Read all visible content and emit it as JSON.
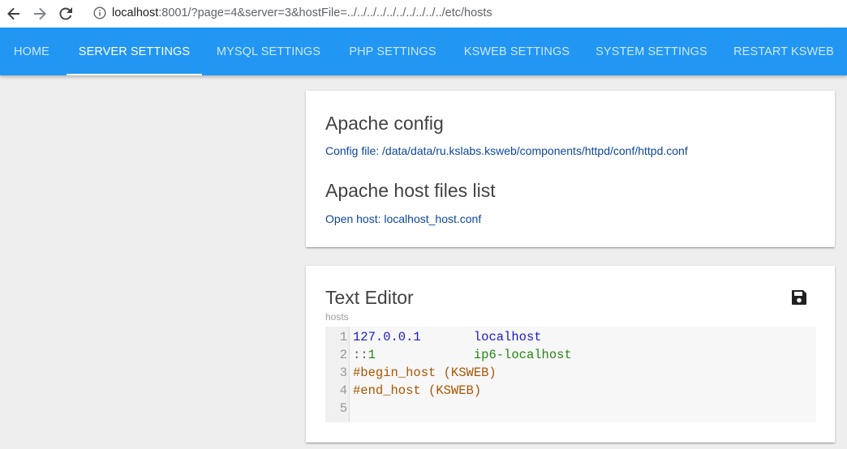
{
  "browser": {
    "url_host": "localhost",
    "url_rest": ":8001/?page=4&server=3&hostFile=../../../../../../../../../../etc/hosts"
  },
  "nav": {
    "tabs": [
      {
        "label": "HOME"
      },
      {
        "label": "SERVER SETTINGS"
      },
      {
        "label": "MYSQL SETTINGS"
      },
      {
        "label": "PHP SETTINGS"
      },
      {
        "label": "KSWEB SETTINGS"
      },
      {
        "label": "SYSTEM SETTINGS"
      },
      {
        "label": "RESTART KSWEB"
      }
    ],
    "active_tab": "SERVER SETTINGS",
    "color": "#2196f3"
  },
  "apache": {
    "title": "Apache config",
    "config_link": "Config file: /data/data/ru.kslabs.ksweb/components/httpd/conf/httpd.conf",
    "hosts_title": "Apache host files list",
    "host_link": "Open host: localhost_host.conf"
  },
  "editor": {
    "title": "Text Editor",
    "file_label": "hosts",
    "save_icon": "floppy-disk-icon",
    "lines": [
      {
        "num": "1",
        "a": "127.0.0.1",
        "pad": "       ",
        "b": "localhost"
      },
      {
        "num": "2",
        "a1": "::",
        "a2": "1",
        "pad": "             ",
        "b": "ip6-localhost"
      },
      {
        "num": "3",
        "comment": "#begin_host (KSWEB)"
      },
      {
        "num": "4",
        "comment": "#end_host (KSWEB)"
      },
      {
        "num": "5"
      }
    ]
  }
}
